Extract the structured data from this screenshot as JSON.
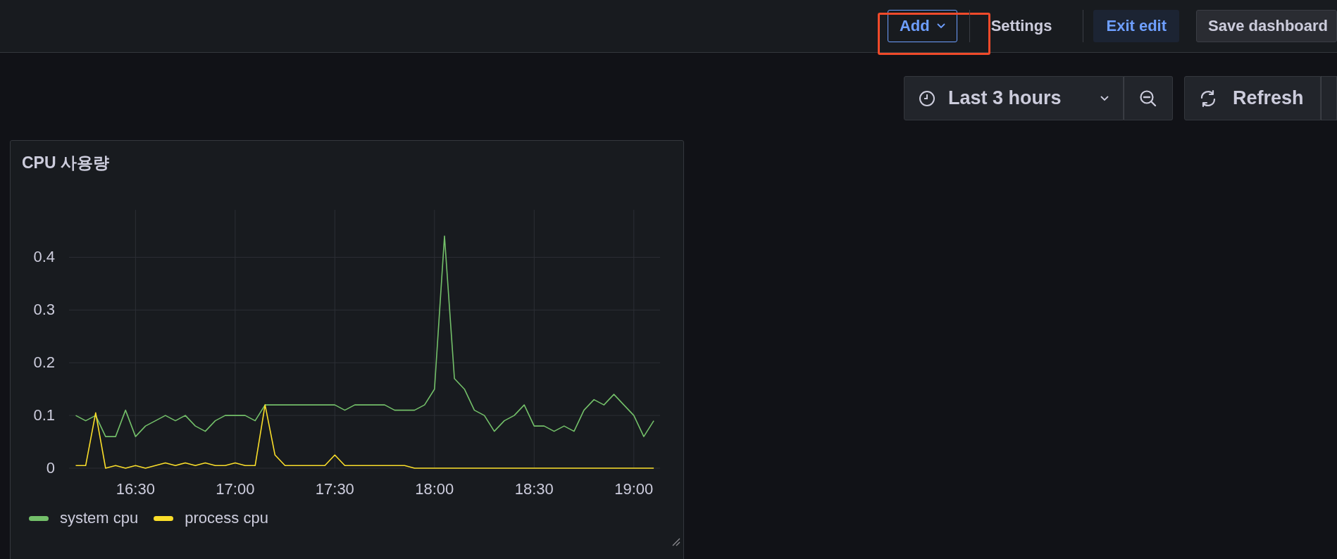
{
  "toolbar": {
    "buttons": [
      {
        "label": "Add",
        "kind": "dropdown",
        "highlighted": true
      },
      {
        "label": "Settings",
        "kind": "plain",
        "highlighted": false
      },
      {
        "label": "Exit edit",
        "kind": "primary",
        "highlighted": false
      },
      {
        "label": "Save dashboard",
        "kind": "secondary",
        "highlighted": false
      }
    ]
  },
  "controls": {
    "time_range": "Last 3 hours",
    "refresh": "Refresh"
  },
  "panel": {
    "title": "CPU 사용량",
    "chart_data": {
      "type": "line",
      "grid": true,
      "ylim": [
        0,
        0.49
      ],
      "yticks": [
        0,
        {
          "value": 0.1,
          "label": "0.1"
        },
        {
          "value": 0.2,
          "label": "0.2"
        },
        {
          "value": 0.3,
          "label": "0.3"
        },
        {
          "value": 0.4,
          "label": "0.4"
        }
      ],
      "categories": [
        null,
        null,
        null,
        null,
        null,
        null,
        "16:30",
        null,
        null,
        null,
        null,
        null,
        null,
        null,
        null,
        null,
        "17:00",
        null,
        null,
        null,
        null,
        null,
        null,
        null,
        null,
        null,
        "17:30",
        null,
        null,
        null,
        null,
        null,
        null,
        null,
        null,
        null,
        "18:00",
        null,
        null,
        null,
        null,
        null,
        null,
        null,
        null,
        null,
        "18:30",
        null,
        null,
        null,
        null,
        null,
        null,
        null,
        null,
        null,
        "19:00",
        null,
        null
      ],
      "series": [
        {
          "name": "system cpu",
          "color": "#73bf69",
          "values": [
            0.1,
            0.09,
            0.1,
            0.06,
            0.06,
            0.11,
            0.06,
            0.08,
            0.09,
            0.1,
            0.09,
            0.1,
            0.08,
            0.07,
            0.09,
            0.1,
            0.1,
            0.1,
            0.09,
            0.12,
            0.12,
            0.12,
            0.12,
            0.12,
            0.12,
            0.12,
            0.12,
            0.11,
            0.12,
            0.12,
            0.12,
            0.12,
            0.11,
            0.11,
            0.11,
            0.12,
            0.15,
            0.44,
            0.17,
            0.15,
            0.11,
            0.1,
            0.07,
            0.09,
            0.1,
            0.12,
            0.08,
            0.08,
            0.07,
            0.08,
            0.07,
            0.11,
            0.13,
            0.12,
            0.14,
            0.12,
            0.1,
            0.06,
            0.09
          ]
        },
        {
          "name": "process cpu",
          "color": "#fade2a",
          "values": [
            0.005,
            0.005,
            0.105,
            0,
            0.005,
            0,
            0.005,
            0,
            0.005,
            0.01,
            0.005,
            0.01,
            0.005,
            0.01,
            0.005,
            0.005,
            0.01,
            0.005,
            0.005,
            0.12,
            0.025,
            0.005,
            0.005,
            0.005,
            0.005,
            0.005,
            0.025,
            0.005,
            0.005,
            0.005,
            0.005,
            0.005,
            0.005,
            0.005,
            0,
            0,
            0,
            0,
            0,
            0,
            0,
            0,
            0,
            0,
            0,
            0,
            0,
            0,
            0,
            0,
            0,
            0,
            0,
            0,
            0,
            0,
            0,
            0,
            0
          ]
        }
      ]
    }
  }
}
